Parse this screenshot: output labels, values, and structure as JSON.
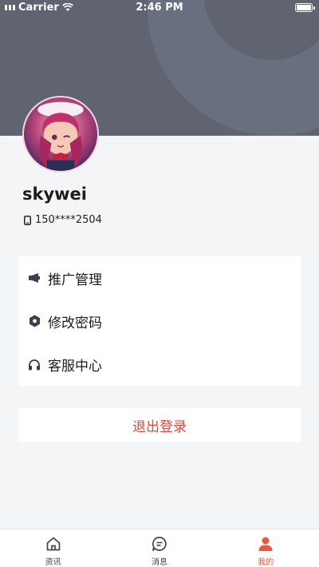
{
  "status_bar": {
    "carrier": "Carrier",
    "time": "2:46 PM"
  },
  "profile": {
    "username": "skywei",
    "phone": "150****2504"
  },
  "menu": [
    {
      "label": "推广管理",
      "icon": "megaphone-icon"
    },
    {
      "label": "修改密码",
      "icon": "hexagon-lock-icon"
    },
    {
      "label": "客服中心",
      "icon": "headset-icon"
    }
  ],
  "logout_label": "退出登录",
  "tabs": [
    {
      "label": "资讯",
      "icon": "home-icon",
      "active": false
    },
    {
      "label": "消息",
      "icon": "message-icon",
      "active": false
    },
    {
      "label": "我的",
      "icon": "person-icon",
      "active": true
    }
  ],
  "colors": {
    "header": "#5f6470",
    "accent": "#e85b3a",
    "logout": "#e2483a",
    "background": "#f4f5f7"
  }
}
